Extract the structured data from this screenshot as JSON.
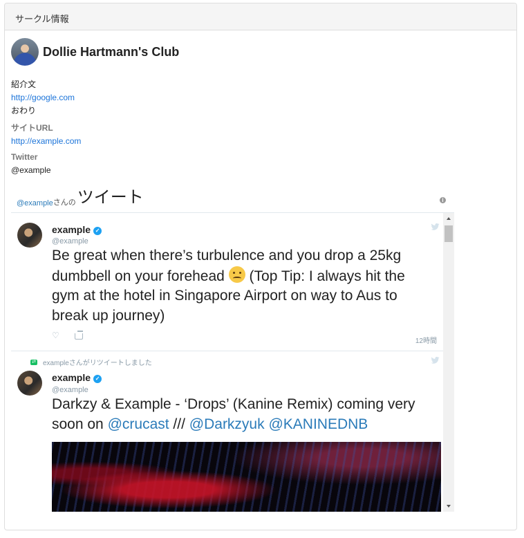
{
  "panel": {
    "heading": "サークル情報"
  },
  "club": {
    "name": "Dollie Hartmann's Club",
    "intro_label": "紹介文",
    "intro_link": "http://google.com",
    "intro_end": "おわり",
    "site_label": "サイトURL",
    "site_url": "http://example.com",
    "twitter_label": "Twitter",
    "twitter_handle": "@example"
  },
  "timeline": {
    "handle": "@example",
    "san_no": "さんの",
    "title": "ツイート",
    "info_icon": "i",
    "tweets": [
      {
        "name": "example",
        "handle": "@example",
        "text_before": "Be great when there’s turbulence and you drop a 25kg dumbbell on your forehead",
        "text_after": " (Top Tip: I always hit the gym at the hotel in Singapore Airport on way to Aus to break up journey)",
        "emoji": "woozy-face",
        "time": "12時間"
      },
      {
        "retweet_note": "exampleさんがリツイートしました",
        "name": "example",
        "handle": "@example",
        "text_plain": "Darkzy & Example - ‘Drops’ (Kanine Remix) coming very soon on ",
        "mention1": "@crucast",
        "sep": " /// ",
        "mention2": "@Darkzyuk",
        "mention3": "@KANINEDNB"
      }
    ]
  },
  "colors": {
    "link": "#1a73d9",
    "tweet_link": "#2b7bb9",
    "verified": "#1da1f2",
    "retweet": "#17bf63"
  }
}
